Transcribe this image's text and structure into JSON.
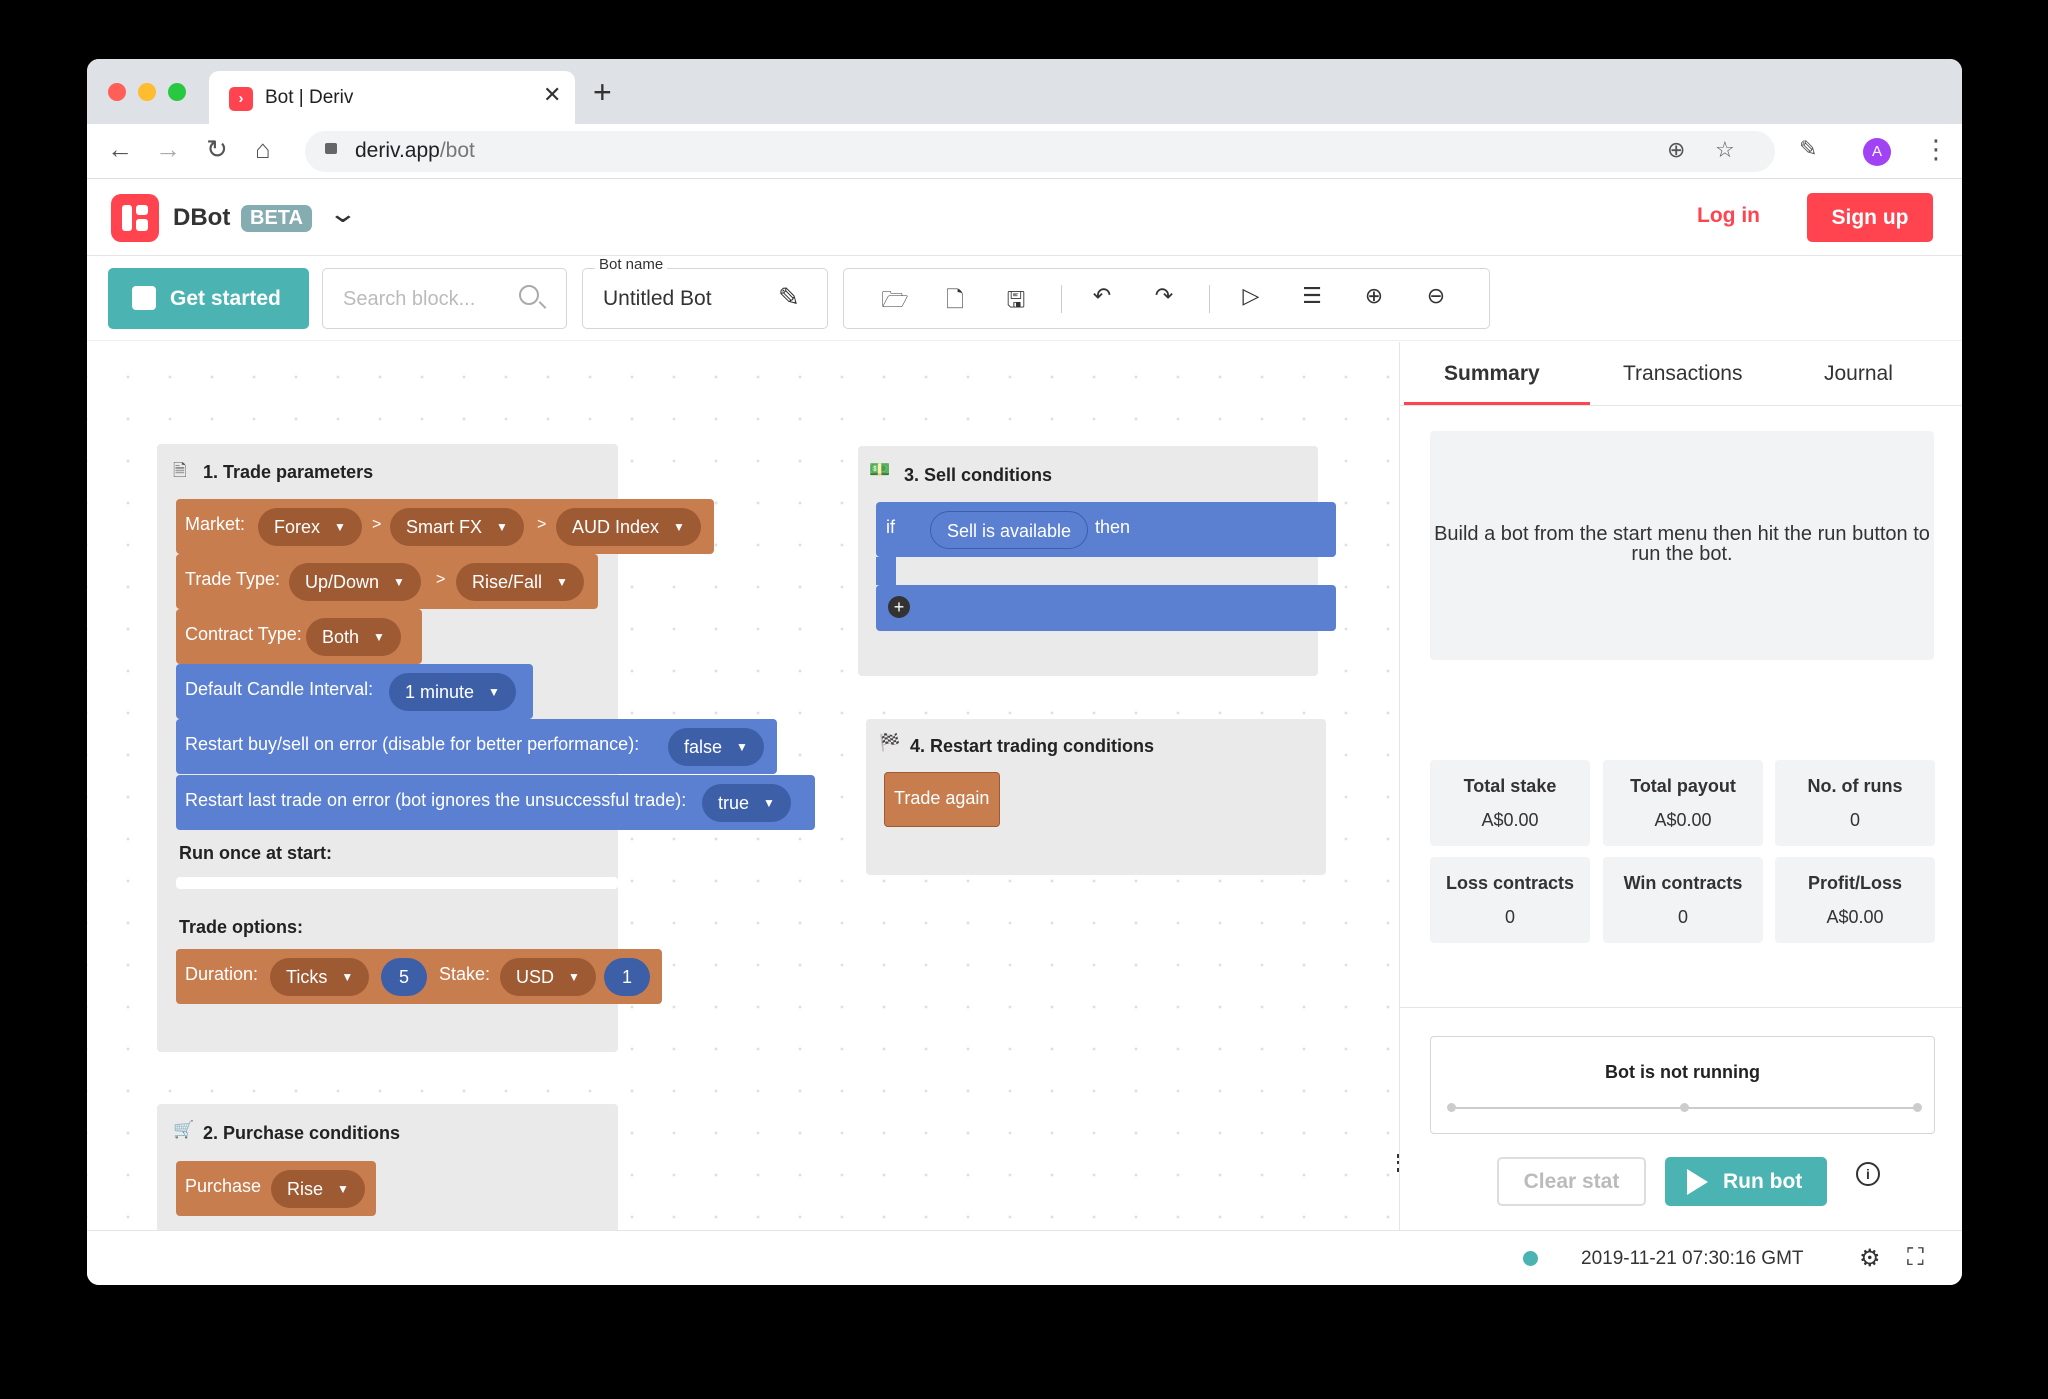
{
  "browser": {
    "tab_title": "Bot | Deriv",
    "url_host": "deriv.app",
    "url_path": "/bot"
  },
  "app": {
    "name": "DBot",
    "badge": "BETA",
    "login_label": "Log in",
    "signup_label": "Sign up",
    "brand_color": "#ff444f"
  },
  "toolbar": {
    "get_started_label": "Get started",
    "search_placeholder": "Search block...",
    "bot_name_label": "Bot name",
    "bot_name_value": "Untitled Bot"
  },
  "workspace": {
    "trade_params": {
      "title": "1. Trade parameters",
      "market_label": "Market:",
      "market": "Forex",
      "submarket": "Smart FX",
      "symbol": "AUD Index",
      "trade_type_label": "Trade Type:",
      "trade_type": "Up/Down",
      "trade_subtype": "Rise/Fall",
      "contract_type_label": "Contract Type:",
      "contract_type": "Both",
      "candle_label": "Default Candle Interval:",
      "candle": "1 minute",
      "restart_buysell_label": "Restart buy/sell on error (disable for better performance):",
      "restart_buysell": "false",
      "restart_last_label": "Restart last trade on error (bot ignores the unsuccessful trade):",
      "restart_last": "true",
      "run_once_label": "Run once at start:",
      "trade_options_label": "Trade options:",
      "duration_label": "Duration:",
      "duration_unit": "Ticks",
      "duration_value": "5",
      "stake_label": "Stake:",
      "currency": "USD",
      "stake_value": "1",
      "separator": ">"
    },
    "purchase": {
      "title": "2. Purchase conditions",
      "purchase_label": "Purchase",
      "purchase_value": "Rise"
    },
    "sell": {
      "title": "3. Sell conditions",
      "if_label": "if",
      "condition": "Sell is available",
      "then_label": "then"
    },
    "restart": {
      "title": "4. Restart trading conditions",
      "trade_again_label": "Trade again"
    }
  },
  "sidebar": {
    "tabs": [
      "Summary",
      "Transactions",
      "Journal"
    ],
    "active_tab": "Summary",
    "info_message": "Build a bot from the start menu then hit the run button to run the bot.",
    "stats": [
      {
        "label": "Total stake",
        "value": "A$0.00"
      },
      {
        "label": "Total payout",
        "value": "A$0.00"
      },
      {
        "label": "No. of runs",
        "value": "0"
      },
      {
        "label": "Loss contracts",
        "value": "0"
      },
      {
        "label": "Win contracts",
        "value": "0"
      },
      {
        "label": "Profit/Loss",
        "value": "A$0.00"
      }
    ],
    "status": "Bot is not running",
    "clear_stat_label": "Clear stat",
    "run_bot_label": "Run bot"
  },
  "footer": {
    "timestamp": "2019-11-21 07:30:16 GMT"
  }
}
